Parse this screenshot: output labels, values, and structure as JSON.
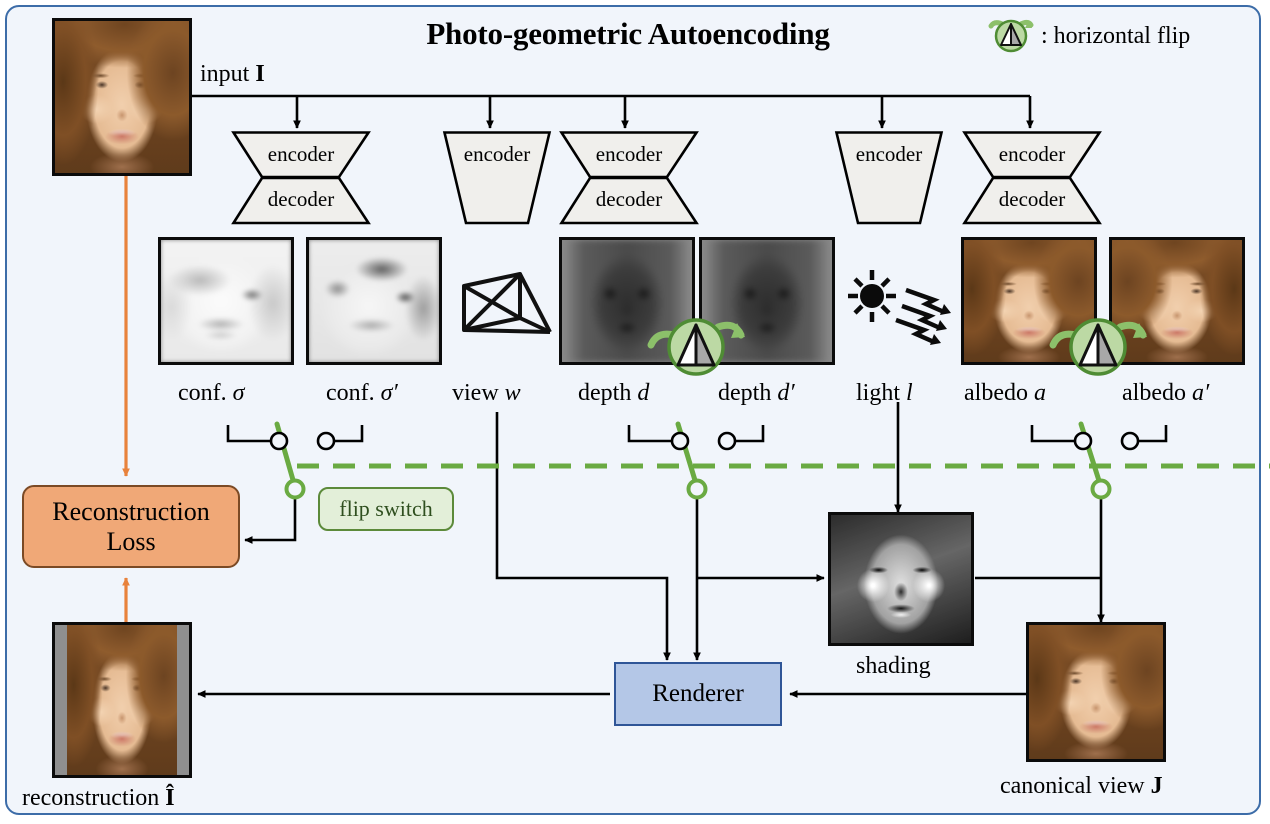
{
  "figure": {
    "title": "Photo-geometric Autoencoding",
    "domain": "diagram",
    "background_color": "#f1f5fb",
    "panel_border_color": "#3c6ca8"
  },
  "legend": {
    "icon": "horizontal-flip-icon",
    "text": ": horizontal flip"
  },
  "labels": {
    "input": "input",
    "input_symbol": "I",
    "conf": "conf.",
    "conf_symbol": "σ",
    "conf_prime_symbol": "σ′",
    "view": "view",
    "view_symbol": "w",
    "depth": "depth",
    "depth_symbol": "d",
    "depth_prime_symbol": "d′",
    "light": "light",
    "light_symbol": "l",
    "albedo": "albedo",
    "albedo_symbol": "a",
    "albedo_prime_symbol": "a′",
    "shading": "shading",
    "reconstruction": "reconstruction",
    "reconstruction_symbol": "Î",
    "canonical_view": "canonical view",
    "canonical_view_symbol": "J"
  },
  "blocks": {
    "encoder": "encoder",
    "decoder": "decoder",
    "recon_loss_line1": "Reconstruction",
    "recon_loss_line2": "Loss",
    "renderer": "Renderer",
    "flip_switch": "flip switch"
  },
  "colors": {
    "recon_loss_fill": "#f0a877",
    "recon_loss_stroke": "#7b4a25",
    "renderer_fill": "#b4c7e7",
    "renderer_stroke": "#2f5597",
    "flip_green": "#6aaa42",
    "flip_green_fill": "#bcd9a4",
    "flip_label_fill": "#e3efd9",
    "flip_label_stroke": "#5c8a3a",
    "loss_arrow": "#e8823c",
    "wire": "#000000"
  },
  "branches": [
    {
      "name": "confidence",
      "outputs": [
        "conf. σ",
        "conf. σ′"
      ],
      "block": "encoder-decoder",
      "has_flip_switch": true
    },
    {
      "name": "viewpoint",
      "outputs": [
        "view w"
      ],
      "block": "encoder",
      "has_flip_switch": false
    },
    {
      "name": "depth",
      "outputs": [
        "depth d",
        "depth d′"
      ],
      "block": "encoder-decoder",
      "has_flip_switch": true
    },
    {
      "name": "lighting",
      "outputs": [
        "light l"
      ],
      "block": "encoder",
      "has_flip_switch": false
    },
    {
      "name": "albedo",
      "outputs": [
        "albedo a",
        "albedo a′"
      ],
      "block": "encoder-decoder",
      "has_flip_switch": true
    }
  ]
}
